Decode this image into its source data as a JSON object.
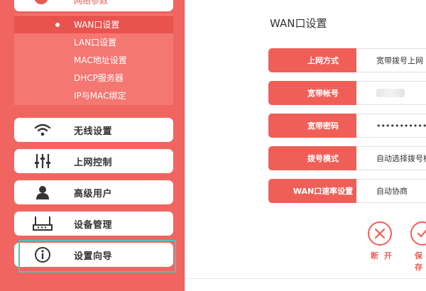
{
  "sidebar": {
    "top_item_label": "网络参数",
    "submenu": [
      {
        "label": "WAN口设置",
        "active": true
      },
      {
        "label": "LAN口设置",
        "active": false
      },
      {
        "label": "MAC地址设置",
        "active": false
      },
      {
        "label": "DHCP服务器",
        "active": false
      },
      {
        "label": "IP与MAC绑定",
        "active": false
      }
    ],
    "items": [
      {
        "label": "无线设置",
        "icon": "wifi-icon"
      },
      {
        "label": "上网控制",
        "icon": "sliders-icon"
      },
      {
        "label": "高级用户",
        "icon": "user-icon"
      },
      {
        "label": "设备管理",
        "icon": "router-icon"
      },
      {
        "label": "设置向导",
        "icon": "info-icon"
      }
    ]
  },
  "content": {
    "title": "WAN口设置",
    "fields": [
      {
        "label": "上网方式",
        "value": "宽带拨号上网"
      },
      {
        "label": "宽带帐号",
        "value": ""
      },
      {
        "label": "宽带密码",
        "value": "••••••••••••••"
      },
      {
        "label": "拨号模式",
        "value": "自动选择拨号模"
      },
      {
        "label": "WAN口速率设置",
        "value": "自动协商"
      }
    ],
    "actions": [
      {
        "label": "断 开",
        "icon": "close-circle-icon"
      },
      {
        "label": "保存",
        "icon": "check-circle-icon"
      }
    ]
  },
  "colors": {
    "accent": "#f0655f",
    "highlight": "#4fc3c3"
  }
}
